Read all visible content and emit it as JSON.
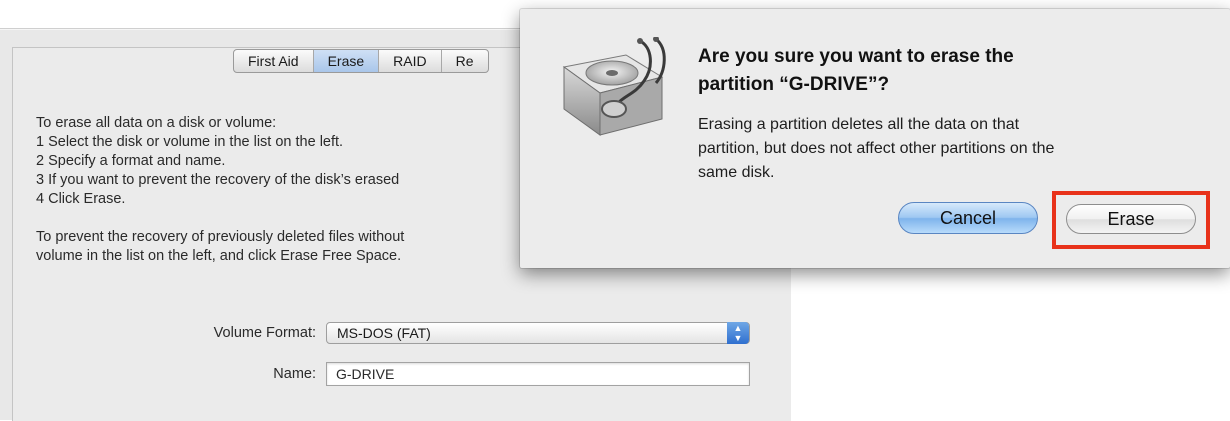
{
  "disk_utility": {
    "tabs": [
      {
        "label": "First Aid",
        "selected": false
      },
      {
        "label": "Erase",
        "selected": true
      },
      {
        "label": "RAID",
        "selected": false
      },
      {
        "label": "Re",
        "selected": false
      }
    ],
    "instructions": [
      "To erase all data on a disk or volume:",
      "1 Select the disk or volume in the list on the left.",
      "2 Specify a format and name.",
      "3 If you want to prevent the recovery of the disk’s erased",
      "4 Click Erase.",
      "",
      "To prevent the recovery of previously deleted files without",
      "volume in the list on the left, and click Erase Free Space."
    ],
    "volume_format_label": "Volume Format:",
    "volume_format_value": "MS-DOS (FAT)",
    "name_label": "Name:",
    "name_value": "G-DRIVE"
  },
  "alert": {
    "icon": "disk-utility-icon",
    "title_line1": "Are you sure you want to erase the",
    "title_line2": "partition “G-DRIVE”?",
    "body_line1": "Erasing a partition deletes all the data on that",
    "body_line2": "partition, but does not affect other partitions on the",
    "body_line3": "same disk.",
    "cancel_label": "Cancel",
    "erase_label": "Erase"
  },
  "colors": {
    "highlight": "#e8321a",
    "default_button": "#8fbdf0",
    "window_background": "#ececec"
  }
}
